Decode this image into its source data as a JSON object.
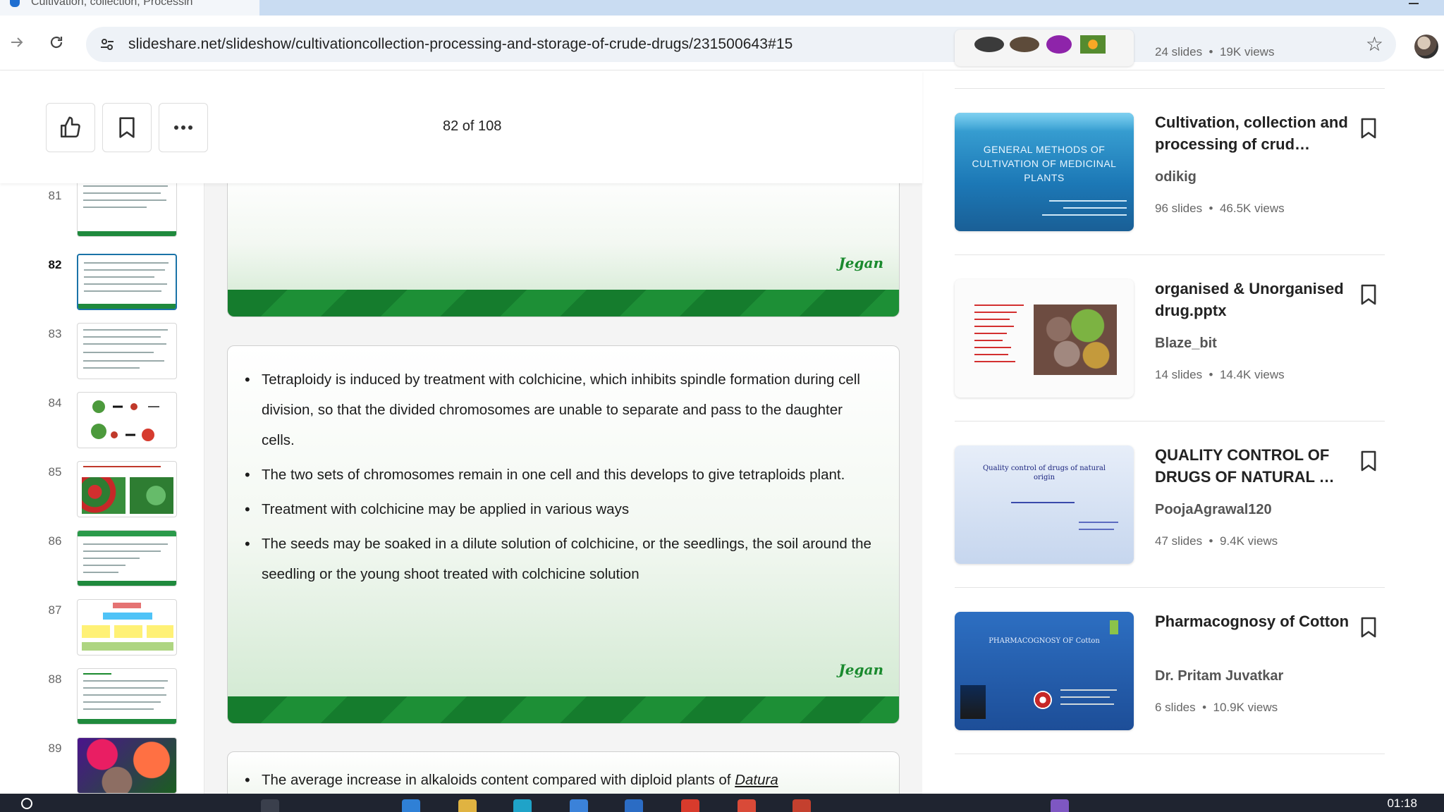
{
  "browser": {
    "tab_title": "Cultivation, collection, Processin",
    "url": "slideshare.net/slideshow/cultivationcollection-processing-and-storage-of-crude-drugs/231500643#15"
  },
  "reader": {
    "page_counter": "82 of 108",
    "thumbnails": [
      {
        "num": "81",
        "current": false,
        "style": "text-green"
      },
      {
        "num": "82",
        "current": true,
        "style": "text-green"
      },
      {
        "num": "83",
        "current": false,
        "style": "text"
      },
      {
        "num": "84",
        "current": false,
        "style": "diagram"
      },
      {
        "num": "85",
        "current": false,
        "style": "photo"
      },
      {
        "num": "86",
        "current": false,
        "style": "text-green"
      },
      {
        "num": "87",
        "current": false,
        "style": "chart"
      },
      {
        "num": "88",
        "current": false,
        "style": "text"
      },
      {
        "num": "89",
        "current": false,
        "style": "flowers"
      }
    ],
    "slides": [
      {
        "signature": "Jegan",
        "bullets": []
      },
      {
        "signature": "Jegan",
        "bullets": [
          "Tetraploidy is induced by treatment with colchicine, which inhibits spindle formation during cell division, so that the divided chromosomes are unable to separate and pass to the daughter cells.",
          "The two sets of chromosomes remain in one cell and this develops to give tetraploids plant.",
          "Treatment with colchicine may be applied in various ways",
          "The seeds may be soaked in a dilute solution of colchicine, or the seedlings, the soil around the seedling or the young shoot treated with colchicine solution"
        ]
      },
      {
        "bullet_partial": "The average increase in alkaloids content compared with diploid plants of ",
        "bullet_italic": "Datura"
      }
    ]
  },
  "related": {
    "top_partial_meta": {
      "slides": "24 slides",
      "views": "19K views"
    },
    "items": [
      {
        "title": "Cultivation, collection and processing of crud…",
        "author": "odikig",
        "slides": "96 slides",
        "views": "46.5K views",
        "cover_text": "GENERAL METHODS OF CULTIVATION OF MEDICINAL PLANTS"
      },
      {
        "title": "organised & Unorganised drug.pptx",
        "author": "Blaze_bit",
        "slides": "14 slides",
        "views": "14.4K views",
        "cover_text": ""
      },
      {
        "title": "QUALITY CONTROL OF DRUGS OF NATURAL …",
        "author": "PoojaAgrawal120",
        "slides": "47 slides",
        "views": "9.4K views",
        "cover_text": "Quality control of drugs of natural origin"
      },
      {
        "title": "Pharmacognosy of Cotton",
        "author": "Dr. Pritam Juvatkar",
        "slides": "6 slides",
        "views": "10.9K views",
        "cover_text": "PHARMACOGNOSY OF Cotton"
      }
    ]
  },
  "taskbar": {
    "clock": "01:18"
  },
  "colors": {
    "accent_green": "#1a8a2e",
    "selected_thumb": "#1a73a8"
  }
}
